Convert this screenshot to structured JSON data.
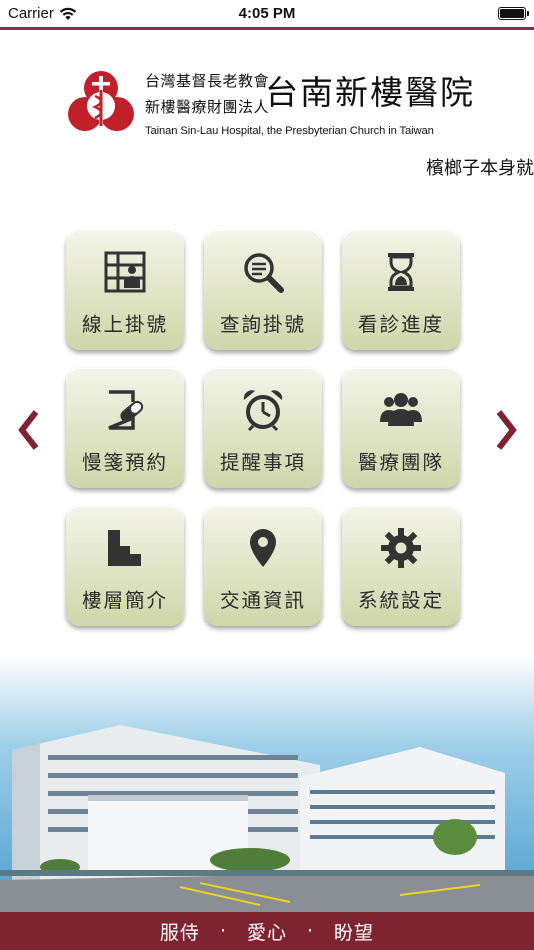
{
  "status_bar": {
    "carrier": "Carrier",
    "time": "4:05 PM",
    "battery_level": 1.0
  },
  "header": {
    "org_line1": "台灣基督長老教會",
    "org_line2": "新樓醫療財團法人",
    "hospital_name": "台南新樓醫院",
    "hospital_name_en": "Tainan Sin-Lau Hospital, the Presbyterian Church in Taiwan",
    "marquee_text": "檳榔子本身就"
  },
  "menu": [
    {
      "label": "線上掛號",
      "icon": "registration-icon"
    },
    {
      "label": "查詢掛號",
      "icon": "search-icon"
    },
    {
      "label": "看診進度",
      "icon": "hourglass-icon"
    },
    {
      "label": "慢箋預約",
      "icon": "prescription-icon"
    },
    {
      "label": "提醒事項",
      "icon": "alarm-clock-icon"
    },
    {
      "label": "醫療團隊",
      "icon": "team-icon"
    },
    {
      "label": "樓層簡介",
      "icon": "floors-icon"
    },
    {
      "label": "交通資訊",
      "icon": "map-pin-icon"
    },
    {
      "label": "系統設定",
      "icon": "gear-icon"
    }
  ],
  "footer": {
    "slogan": [
      "服侍",
      "·",
      "愛心",
      "·",
      "盼望"
    ]
  },
  "colors": {
    "accent": "#9b2a2a",
    "tile_base": "#dfe3c3",
    "footer_bg": "#7e2430"
  }
}
